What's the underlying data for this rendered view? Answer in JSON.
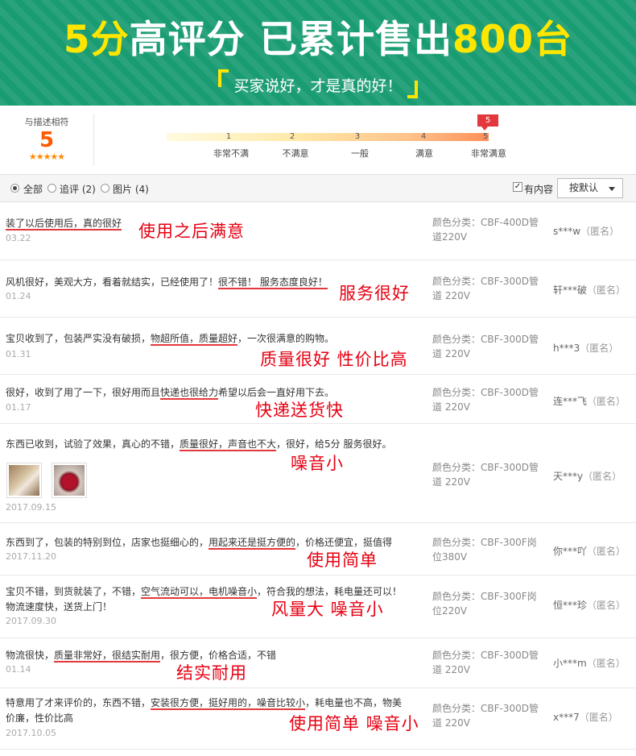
{
  "banner": {
    "headline": {
      "part1": "5分",
      "part2": "高评分 已累计售出",
      "part3": "800台"
    },
    "subtitle": "买家说好，才是真的好！"
  },
  "rating": {
    "desc_label": "与描述相符",
    "score": "5",
    "stars": "★★★★★",
    "selected": "5",
    "scale": [
      {
        "num": "1",
        "label": "非常不满"
      },
      {
        "num": "2",
        "label": "不满意"
      },
      {
        "num": "3",
        "label": "一般"
      },
      {
        "num": "4",
        "label": "满意"
      },
      {
        "num": "5",
        "label": "非常满意"
      }
    ]
  },
  "filters": {
    "all": "全部",
    "append": "追评 (2)",
    "photo": "图片 (4)",
    "has_content": "有内容",
    "sort": "按默认"
  },
  "reviews": [
    {
      "t1": "装了以后使用后，真的很好",
      "t2": "",
      "t3": "",
      "t4": "",
      "t5": "",
      "date": "03.22",
      "note": "使用之后满意",
      "spec": "颜色分类：CBF-400D管道220V",
      "user": "s***w",
      "anon": "（匿名）"
    },
    {
      "t1": "风机很好，美观大方，看着就结实，已经使用了！",
      "t2": "很不错！ 服务态度良好！",
      "t3": "",
      "t4": "",
      "t5": "",
      "date": "01.24",
      "note": "服务很好",
      "spec": "颜色分类：CBF-300D管道 220V",
      "user": "轩***破",
      "anon": "（匿名）"
    },
    {
      "t1": "宝贝收到了，包装严实没有破损，",
      "t2": "物超所值，质量超好",
      "t3": "，一次很满意的购物。",
      "t4": "",
      "t5": "",
      "date": "01.31",
      "note": "质量很好 性价比高",
      "spec": "颜色分类：CBF-300D管道 220V",
      "user": "h***3",
      "anon": "（匿名）"
    },
    {
      "t1": "很好，收到了用了一下，很好用而且",
      "t2": "快递也很给力",
      "t3": "希望以后会一直好用下去。",
      "t4": "",
      "t5": "",
      "date": "01.17",
      "note": "快递送货快",
      "spec": "颜色分类：CBF-300D管道 220V",
      "user": "连***飞",
      "anon": "（匿名）"
    },
    {
      "t1": "东西已收到，试验了效果，真心的不错，",
      "t2": "质量很好，声音也不大",
      "t3": "，很好，给5分 服务很好。",
      "t4": "",
      "t5": "",
      "date": "2017.09.15",
      "note": "噪音小",
      "spec": "颜色分类：CBF-300D管道 220V",
      "user": "天***y",
      "anon": "（匿名）"
    },
    {
      "t1": "东西到了，包装的特别到位，店家也挺细心的，",
      "t2": "用起来还是挺方便的",
      "t3": "，价格还便宜，挺值得",
      "t4": "",
      "t5": "",
      "date": "2017.11.20",
      "note": "使用简单",
      "spec": "颜色分类：CBF-300F岗位380V",
      "user": "你***吖",
      "anon": "（匿名）"
    },
    {
      "t1": "宝贝不错，到货就装了，不错，",
      "t2": "空气流动可以，电机噪音小",
      "t3": "，符合我的想法，耗电量还可以！物流速度快，送货上门！",
      "t4": "",
      "t5": "",
      "date": "2017.09.30",
      "note": "风量大 噪音小",
      "spec": "颜色分类：CBF-300F岗位220V",
      "user": "恒***珍",
      "anon": "（匿名）"
    },
    {
      "t1": "物流很快，",
      "t2": "质量非常好，很结实耐用",
      "t3": "，很方便，价格合适，不错",
      "t4": "",
      "t5": "",
      "date": "01.14",
      "note": "结实耐用",
      "spec": "颜色分类：CBF-300D管道 220V",
      "user": "小***m",
      "anon": "（匿名）"
    },
    {
      "t1": "特意用了才来评价的，东西不错，",
      "t2": "安装很方便，挺好用的，噪音比较小",
      "t3": "，耗电量也不高，物美价廉，性价比高",
      "t4": "",
      "t5": "",
      "date": "2017.10.05",
      "note": "使用简单 噪音小",
      "spec": "颜色分类：CBF-300D管道 220V",
      "user": "x***7",
      "anon": "（匿名）"
    }
  ],
  "colors": {
    "banner_green": "#1a9c73",
    "highlight_yellow": "#ffe600",
    "accent_red": "#e4393c",
    "score_orange": "#ff5a00"
  }
}
